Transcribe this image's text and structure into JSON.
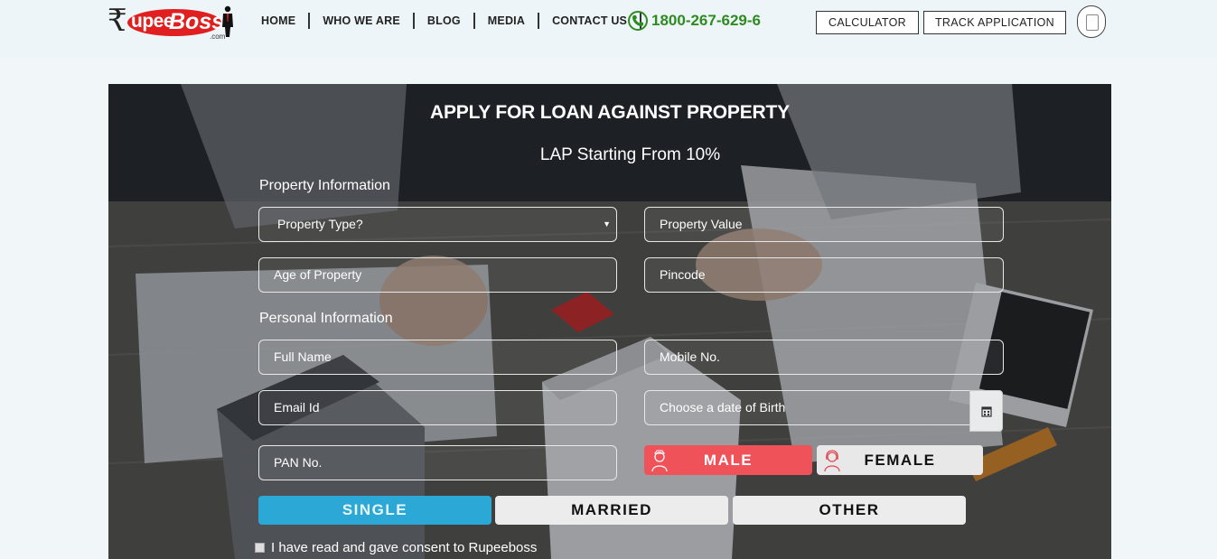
{
  "brand": {
    "logo_main": "upee",
    "logo_accent": "Boss",
    "logo_suffix": ".com",
    "rupee_symbol": "₹"
  },
  "nav": {
    "items": [
      {
        "label": "HOME"
      },
      {
        "label": "WHO WE ARE"
      },
      {
        "label": "BLOG"
      },
      {
        "label": "MEDIA"
      },
      {
        "label": "CONTACT US"
      }
    ],
    "phone": "1800-267-629-6",
    "phone_icon": "phone-icon",
    "calculator_label": "CALCULATOR",
    "track_label": "TRACK APPLICATION",
    "menu_icon": "mobile-menu-icon"
  },
  "form": {
    "title": "APPLY FOR LOAN AGAINST PROPERTY",
    "subtitle": "LAP Starting From 10%",
    "property_section": "Property Information",
    "personal_section": "Personal Information",
    "property_type_placeholder": "Property Type?",
    "property_value_placeholder": "Property Value",
    "age_placeholder": "Age of Property",
    "pincode_placeholder": "Pincode",
    "full_name_placeholder": "Full Name",
    "mobile_placeholder": "Mobile No.",
    "email_placeholder": "Email Id",
    "dob_placeholder": "Choose a date of Birth",
    "pan_placeholder": "PAN No.",
    "gender": {
      "male": "MALE",
      "female": "FEMALE",
      "selected": "MALE"
    },
    "marital": {
      "single": "SINGLE",
      "married": "MARRIED",
      "other": "OTHER",
      "selected": "SINGLE"
    },
    "consent_text": "I have read and gave consent to Rupeeboss",
    "consent_checked": false
  },
  "colors": {
    "brand_red": "#e02020",
    "phone_green": "#2e8b22",
    "male_active": "#f0525a",
    "single_active": "#2ba8d6"
  }
}
